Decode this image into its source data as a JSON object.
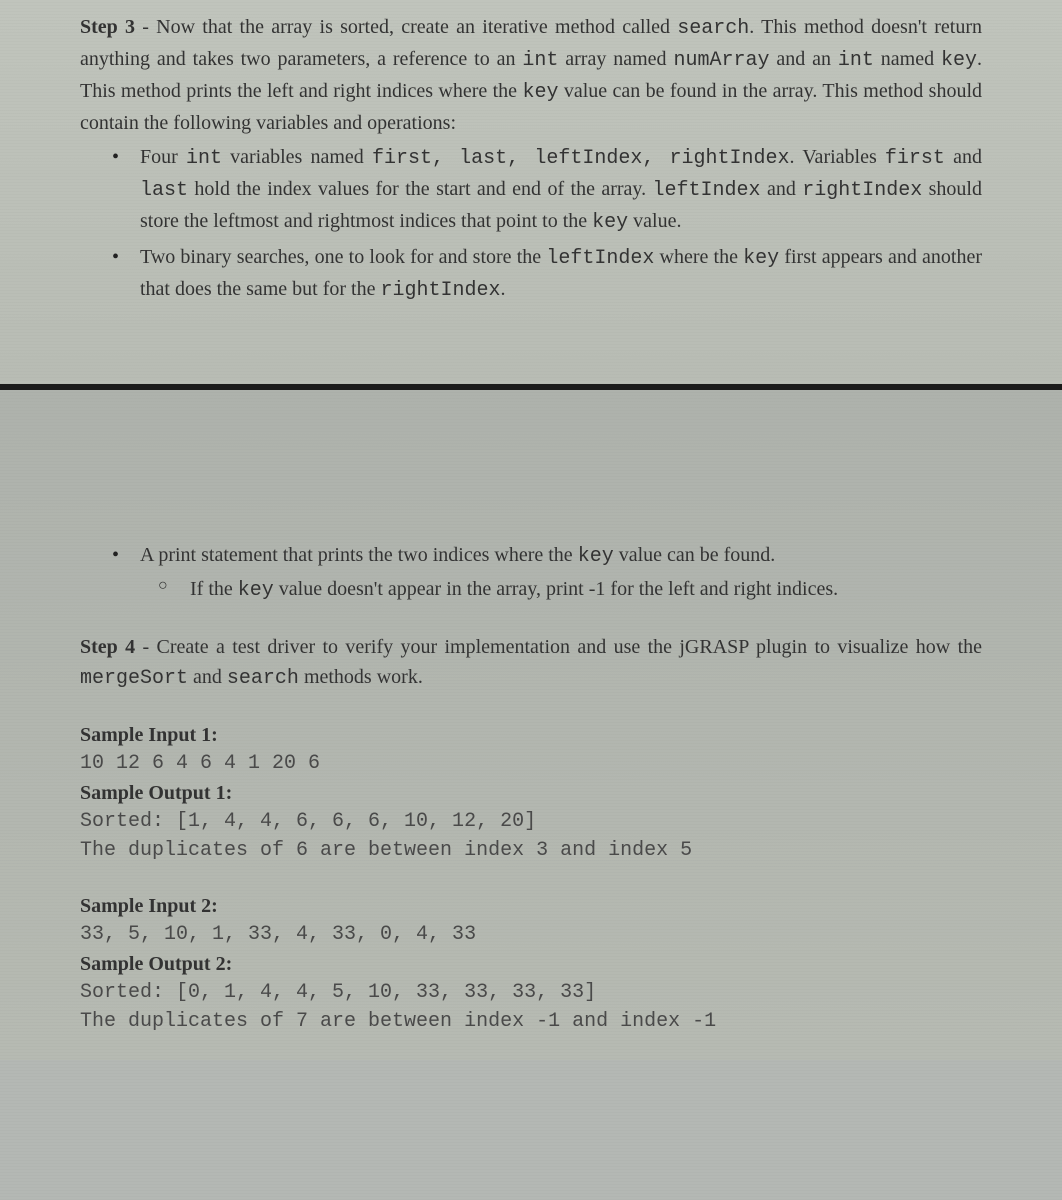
{
  "step3": {
    "intro_html": "<span class='bold'>Step 3</span> - Now that the array is sorted, create an iterative method called <span class='mono'>search</span>. This method doesn't return anything and takes two parameters, a reference to an <span class='mono'>int</span> array named <span class='mono'>numArray</span> and an <span class='mono'>int</span> named <span class='mono'>key</span>. This method prints the left and right indices where the <span class='mono'>key</span> value can be found in the array. This method should contain the following variables and operations:",
    "bullet1_html": "Four <span class='mono'>int</span> variables named <span class='mono'>first, last, leftIndex, rightIndex</span>. Variables <span class='mono'>first</span> and <span class='mono'>last</span> hold the index values for the start and end of the array. <span class='mono'>leftIndex</span> and <span class='mono'>rightIndex</span> should store the leftmost and rightmost indices that point to the <span class='mono'>key</span> value.",
    "bullet2_html": "Two binary searches, one to look for and store the <span class='mono'>leftIndex</span> where the <span class='mono'>key</span> first appears and another that does the same but for the <span class='mono'>rightIndex</span>.",
    "bullet3_html": "A print statement that prints the two indices where the <span class='mono'>key</span> value can be found.",
    "bullet3_nested_html": "If the <span class='mono'>key</span> value doesn't appear in the array, print -1 for the left and right indices."
  },
  "step4": {
    "text_html": "<span class='bold'>Step 4</span> - Create a test driver to verify your implementation and use the jGRASP plugin to visualize how the <span class='mono'>mergeSort</span> and <span class='mono'>search</span> methods work."
  },
  "sample1": {
    "input_label": "Sample Input 1:",
    "input_text": "10 12 6 4 6 4 1 20 6",
    "output_label": "Sample Output 1:",
    "output_text": "Sorted: [1, 4, 4, 6, 6, 6, 10, 12, 20]\nThe duplicates of 6 are between index 3 and index 5"
  },
  "sample2": {
    "input_label": "Sample Input 2:",
    "input_text": "33, 5, 10, 1, 33, 4, 33, 0, 4, 33",
    "output_label": "Sample Output 2:",
    "output_text": "Sorted: [0, 1, 4, 4, 5, 10, 33, 33, 33, 33]\nThe duplicates of 7 are between index -1 and index -1"
  }
}
